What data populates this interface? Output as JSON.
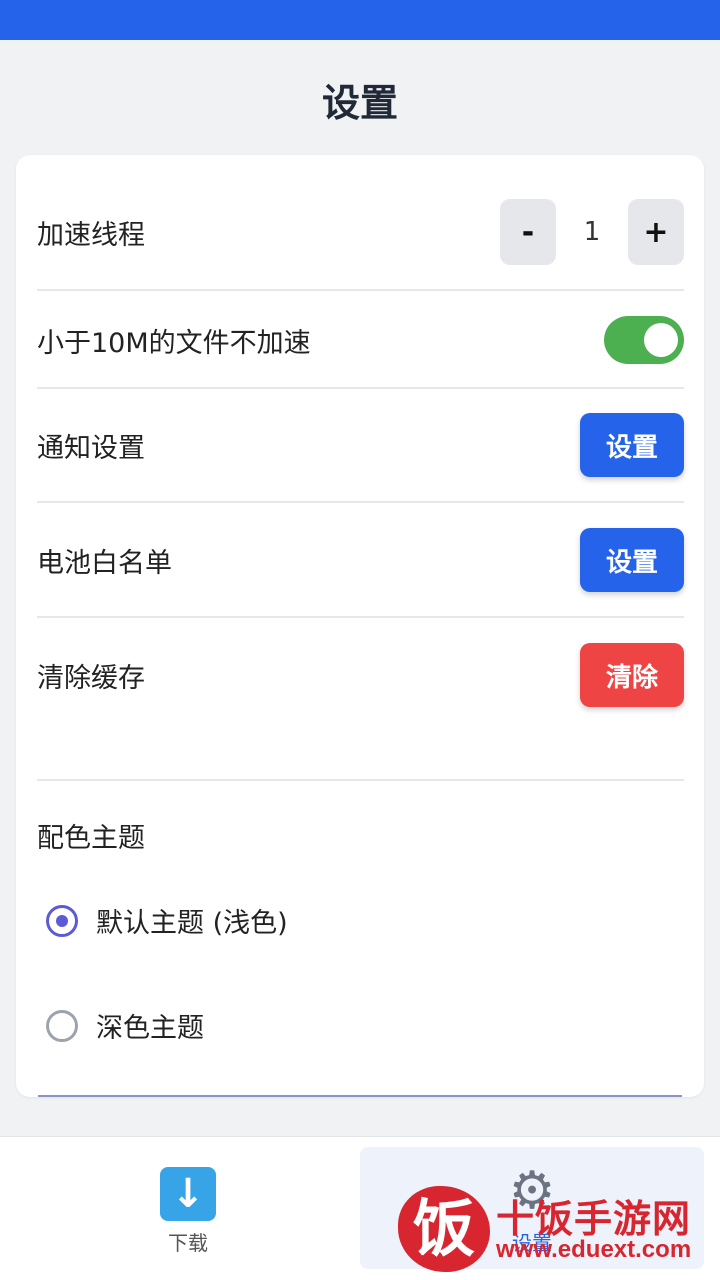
{
  "page": {
    "title": "设置"
  },
  "settings": {
    "threads": {
      "label": "加速线程",
      "decrement": "-",
      "value": "1",
      "increment": "+"
    },
    "skip_small": {
      "label": "小于10M的文件不加速",
      "enabled": true
    },
    "notification": {
      "label": "通知设置",
      "button": "设置"
    },
    "battery": {
      "label": "电池白名单",
      "button": "设置"
    },
    "cache": {
      "label": "清除缓存",
      "button": "清除"
    }
  },
  "theme": {
    "label": "配色主题",
    "options": [
      {
        "label": "默认主题 (浅色)",
        "selected": true
      },
      {
        "label": "深色主题",
        "selected": false
      }
    ]
  },
  "bottom_nav": {
    "items": [
      {
        "label": "下载",
        "icon": "download-icon",
        "active": false
      },
      {
        "label": "设置",
        "icon": "gear-icon",
        "active": true
      }
    ]
  },
  "watermark": {
    "seal_char": "饭",
    "name": "十饭手游网",
    "url": "www.eduext.com"
  },
  "colors": {
    "primary": "#2563eb",
    "danger": "#ef4444",
    "toggle_on": "#4caf50",
    "radio_selected": "#5b5bd6"
  }
}
